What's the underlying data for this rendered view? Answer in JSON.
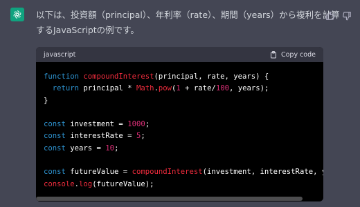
{
  "message": {
    "text": "以下は、投資額（principal）、年利率（rate）、期間（years）から複利を計算するJavaScriptの例です。"
  },
  "feedback": {
    "like_icon": "thumbs-up-icon",
    "dislike_icon": "thumbs-down-icon"
  },
  "code_block": {
    "language": "javascript",
    "copy_label": "Copy code",
    "copy_icon": "clipboard-icon",
    "lines": [
      [
        {
          "t": "function ",
          "c": "kw"
        },
        {
          "t": "compoundInterest",
          "c": "fn"
        },
        {
          "t": "(principal, rate, years) {",
          "c": ""
        }
      ],
      [
        {
          "t": "  ",
          "c": ""
        },
        {
          "t": "return",
          "c": "kw"
        },
        {
          "t": " principal * ",
          "c": ""
        },
        {
          "t": "Math",
          "c": "fn"
        },
        {
          "t": ".",
          "c": ""
        },
        {
          "t": "pow",
          "c": "fn"
        },
        {
          "t": "(",
          "c": ""
        },
        {
          "t": "1",
          "c": "num"
        },
        {
          "t": " + rate/",
          "c": ""
        },
        {
          "t": "100",
          "c": "num"
        },
        {
          "t": ", years);",
          "c": ""
        }
      ],
      [
        {
          "t": "}",
          "c": ""
        }
      ],
      [],
      [
        {
          "t": "const",
          "c": "kw"
        },
        {
          "t": " investment = ",
          "c": ""
        },
        {
          "t": "1000",
          "c": "num"
        },
        {
          "t": ";",
          "c": ""
        }
      ],
      [
        {
          "t": "const",
          "c": "kw"
        },
        {
          "t": " interestRate = ",
          "c": ""
        },
        {
          "t": "5",
          "c": "num"
        },
        {
          "t": ";",
          "c": ""
        }
      ],
      [
        {
          "t": "const",
          "c": "kw"
        },
        {
          "t": " years = ",
          "c": ""
        },
        {
          "t": "10",
          "c": "num"
        },
        {
          "t": ";",
          "c": ""
        }
      ],
      [],
      [
        {
          "t": "const",
          "c": "kw"
        },
        {
          "t": " futureValue = ",
          "c": ""
        },
        {
          "t": "compoundInterest",
          "c": "fn"
        },
        {
          "t": "(investment, interestRate, years);",
          "c": ""
        }
      ],
      [
        {
          "t": "console",
          "c": "fn"
        },
        {
          "t": ".",
          "c": ""
        },
        {
          "t": "log",
          "c": "fn"
        },
        {
          "t": "(futureValue);",
          "c": ""
        }
      ]
    ]
  },
  "colors": {
    "background": "#444654",
    "avatar": "#10a37f",
    "code_bg": "#000000",
    "header_bg": "#343541",
    "keyword": "#2e95d3",
    "function": "#f22c3d",
    "number": "#df3079"
  }
}
